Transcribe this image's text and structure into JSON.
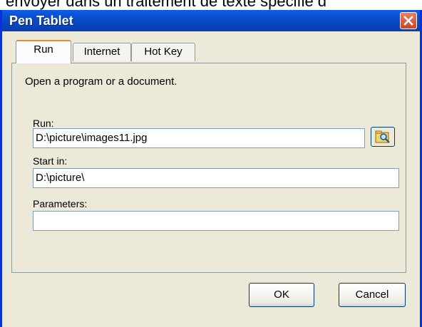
{
  "background_text": "envoyer dans un traitement de texte spécifié d",
  "window": {
    "title": "Pen Tablet"
  },
  "tabs": [
    {
      "label": "Run",
      "active": true
    },
    {
      "label": "Internet",
      "active": false
    },
    {
      "label": "Hot Key",
      "active": false
    }
  ],
  "run_tab": {
    "description": "Open a program or a document.",
    "run_label": "Run:",
    "run_value": "D:\\picture\\images11.jpg",
    "start_in_label": "Start in:",
    "start_in_value": "D:\\picture\\",
    "parameters_label": "Parameters:",
    "parameters_value": ""
  },
  "buttons": {
    "ok": "OK",
    "cancel": "Cancel"
  },
  "icons": {
    "close": "close-icon",
    "browse": "browse-folder-icon"
  }
}
